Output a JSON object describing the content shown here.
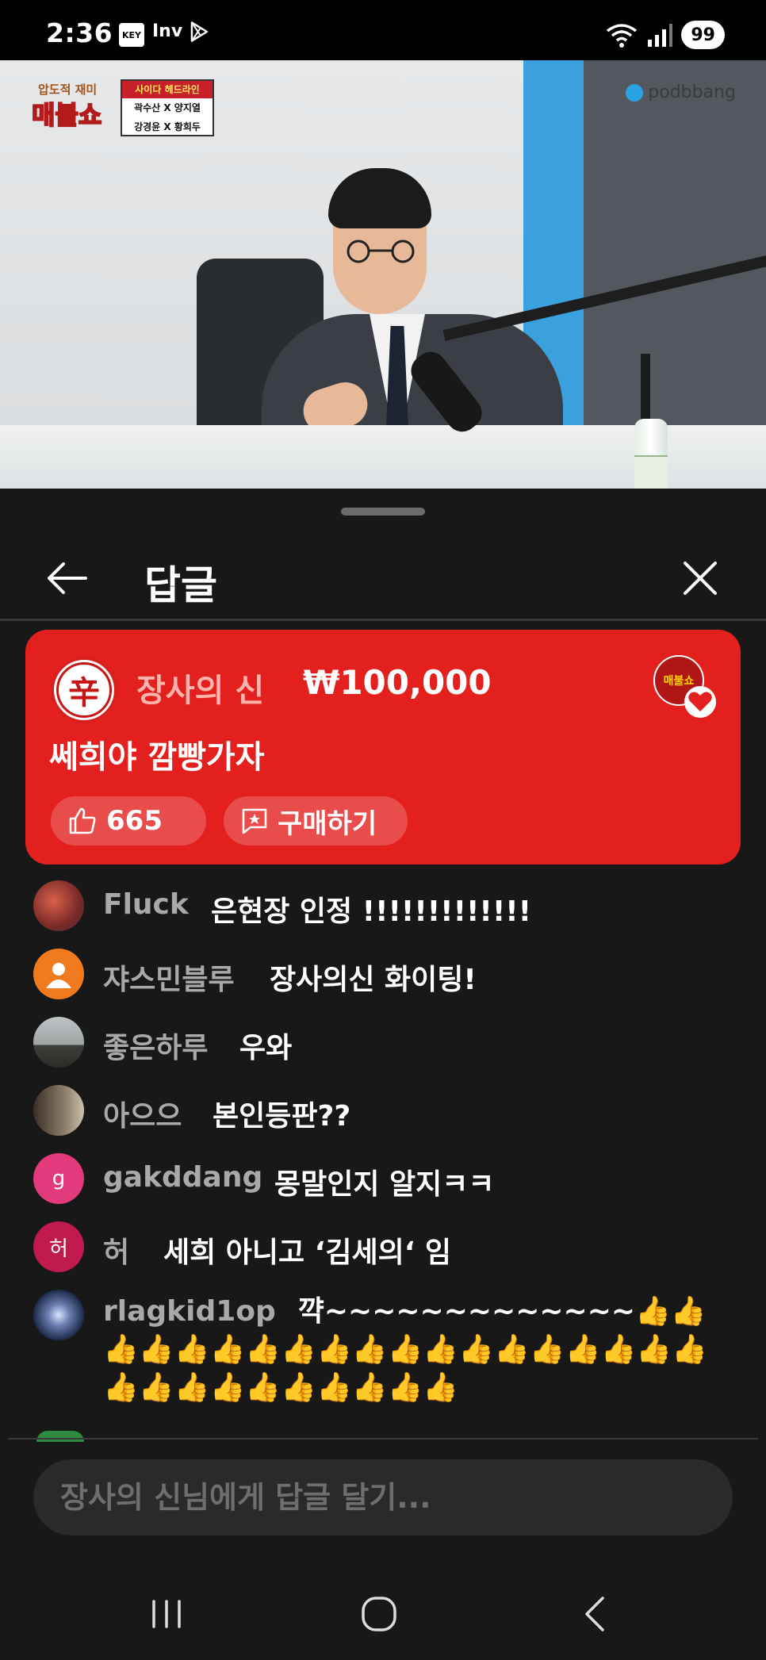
{
  "status_bar": {
    "time": "2:36",
    "app_icons": [
      "KEY",
      "Inv"
    ],
    "battery": "99"
  },
  "video": {
    "show_logo_top": "압도적 재미",
    "show_logo_main": "매불쇼",
    "badge_title": "사이다 헤드라인",
    "badge_row1": "곽수산 X 양지열",
    "badge_row2": "강경윤 X 황희두",
    "channel_watermark": "podbbang"
  },
  "sheet": {
    "title": "답글"
  },
  "donation": {
    "donor_avatar_char": "辛",
    "donor_name": "장사의 신",
    "amount": "₩100,000",
    "message": "쎄희야 깜빵가자",
    "channel_logo": "매불쇼",
    "likes": "665",
    "buy_label": "구매하기",
    "color": "#e3201e"
  },
  "comments": [
    {
      "name": "Fluck",
      "text": "은현장 인정 !!!!!!!!!!!!!",
      "avatar": "image"
    },
    {
      "name": "쟈스민블루",
      "text": "장사의신 화이팅!",
      "avatar": "person-icon"
    },
    {
      "name": "좋은하루",
      "text": "우와",
      "avatar": "image"
    },
    {
      "name": "아으으",
      "text": "본인등판??",
      "avatar": "image"
    },
    {
      "name": "gakddang",
      "text": "몽말인지 알지ㅋㅋ",
      "avatar_letter": "g"
    },
    {
      "name": "허",
      "text": "세희 아니고 ‘김세의‘ 임",
      "avatar_letter": "허"
    },
    {
      "name": "rlagkid1op",
      "text": "꺅~~~~~~~~~~~~~👍👍👍👍👍👍👍👍👍👍👍👍👍👍👍👍👍👍👍👍👍👍👍👍👍👍👍👍👍",
      "avatar": "image"
    }
  ],
  "reply_input": {
    "placeholder": "장사의 신님에게 답글 달기..."
  }
}
